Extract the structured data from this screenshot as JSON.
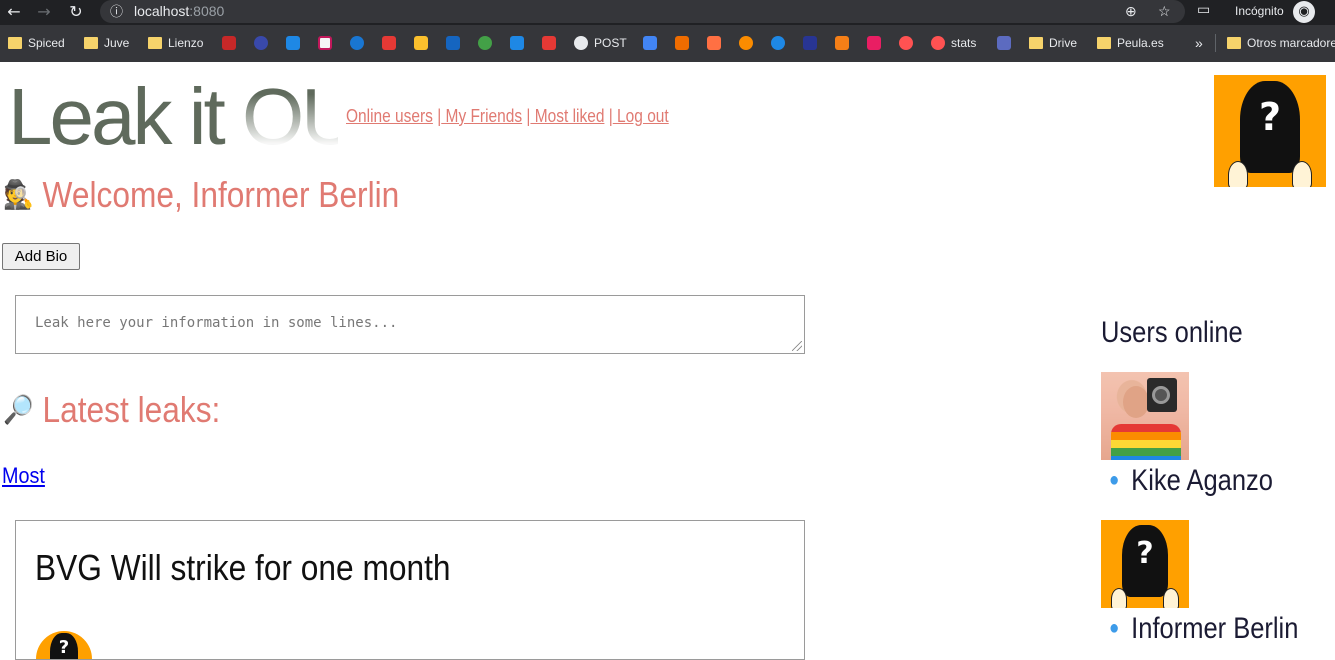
{
  "browser": {
    "url_host": "localhost",
    "url_port": ":8080",
    "incognito_label": "Incógnito",
    "bookmarks": [
      {
        "label": "Spiced",
        "type": "folder"
      },
      {
        "label": "Juve",
        "type": "folder"
      },
      {
        "label": "Lienzo",
        "type": "folder"
      },
      {
        "label": "POST",
        "type": "link"
      },
      {
        "label": "stats",
        "type": "link"
      },
      {
        "label": "Drive",
        "type": "folder"
      },
      {
        "label": "Peula.es",
        "type": "folder"
      },
      {
        "label": "»",
        "type": "overflow"
      },
      {
        "label": "Otros marcadores",
        "type": "folder"
      }
    ]
  },
  "header": {
    "logo_text_main": "Leak it ",
    "logo_text_out": "OUT",
    "nav": {
      "online_users": "Online users",
      "sep1": " |",
      "my_friends": " My Friends",
      "sep2": " |",
      "most_liked": " Most liked",
      "sep3": " |",
      "log_out": " Log out"
    },
    "profile_pic_icon": "anonymous-user-icon"
  },
  "welcome": {
    "emoji": "🕵",
    "text": "Welcome, Informer Berlin"
  },
  "add_bio_label": "Add Bio",
  "leak_input": {
    "placeholder": "Leak here your information in some lines...",
    "value": ""
  },
  "latest": {
    "emoji": "🔎",
    "title": "Latest leaks:",
    "sort_link": "Most"
  },
  "leaks": [
    {
      "title": "BVG Will strike for one month",
      "author_icon": "anonymous-user-icon"
    }
  ],
  "online_users": {
    "title": "Users online",
    "users": [
      {
        "name": "Kike Aganzo",
        "icon": "user-photo"
      },
      {
        "name": "Informer Berlin",
        "icon": "anonymous-user-icon"
      }
    ]
  },
  "colors": {
    "accent": "#e07a72",
    "logo": "#5f6a5c",
    "anon_bg": "#ffa000",
    "bullet": "#3d9be9",
    "text_dark": "#1b1b33"
  }
}
